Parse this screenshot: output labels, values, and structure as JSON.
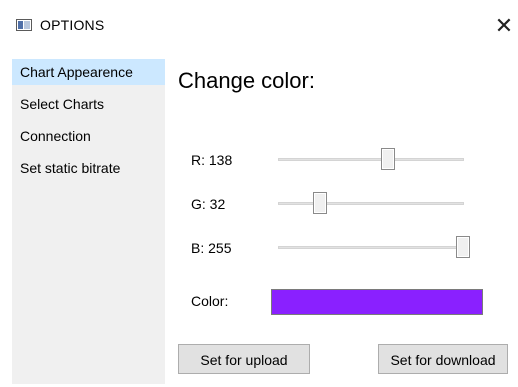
{
  "window": {
    "title": "OPTIONS",
    "close_glyph": "✕"
  },
  "sidebar": {
    "items": [
      {
        "label": "Chart Appearence",
        "selected": true
      },
      {
        "label": "Select Charts",
        "selected": false
      },
      {
        "label": "Connection",
        "selected": false
      },
      {
        "label": "Set static bitrate",
        "selected": false
      }
    ]
  },
  "main": {
    "heading": "Change color:",
    "sliders": [
      {
        "label": "R: 138",
        "value": 138,
        "max": 255
      },
      {
        "label": "G: 32",
        "value": 32,
        "max": 255
      },
      {
        "label": "B: 255",
        "value": 255,
        "max": 255
      }
    ],
    "color_label": "Color:",
    "color_value": "#8a20ff",
    "buttons": {
      "upload": "Set for upload",
      "download": "Set for download"
    }
  },
  "icons": {
    "app": "window-icon",
    "close": "close-icon"
  }
}
